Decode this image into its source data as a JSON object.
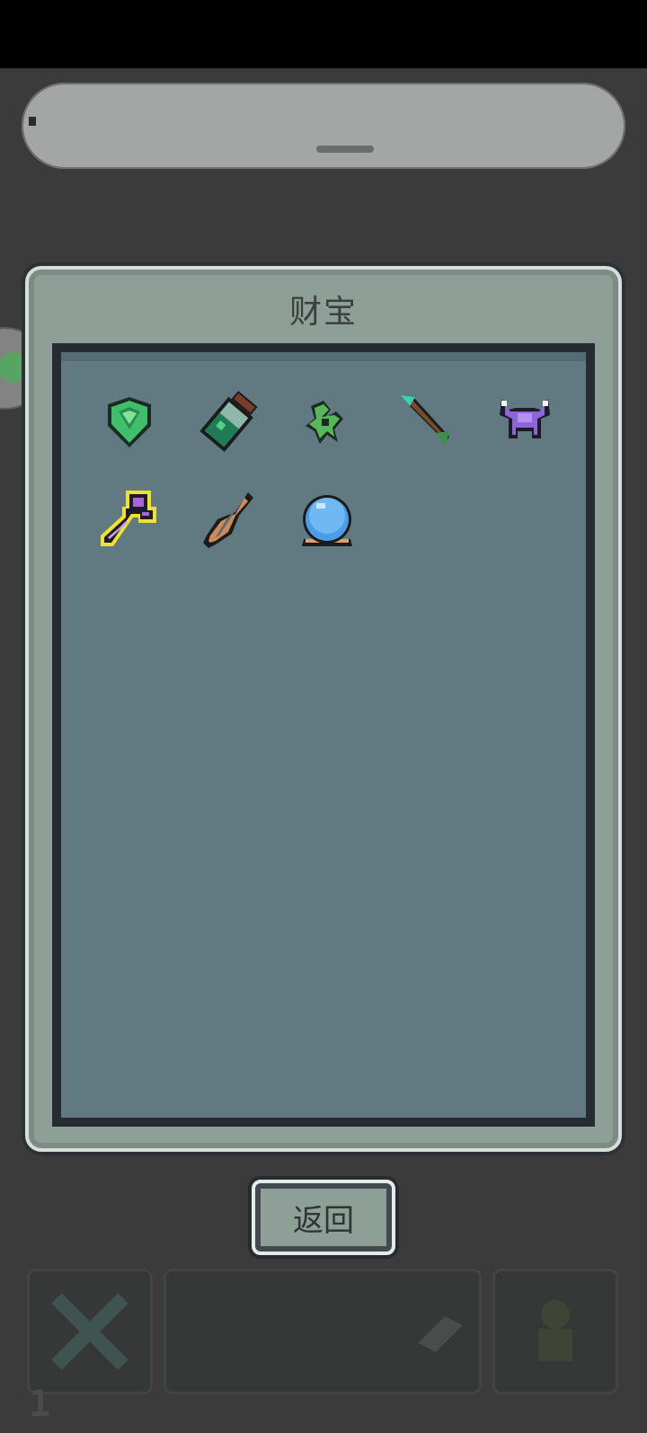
{
  "panel": {
    "title": "财宝"
  },
  "treasures": [
    {
      "name": "green-gem-icon"
    },
    {
      "name": "potion-jar-icon"
    },
    {
      "name": "green-wings-icon"
    },
    {
      "name": "arrow-icon"
    },
    {
      "name": "horned-armor-icon"
    },
    {
      "name": "purple-key-icon"
    },
    {
      "name": "feather-quill-icon"
    },
    {
      "name": "crystal-ball-icon"
    }
  ],
  "selected_index": 5,
  "buttons": {
    "return_label": "返回"
  },
  "background_hud": {
    "slot_number": "1"
  },
  "colors": {
    "panel": "#8e9f97",
    "inner": "#617a82",
    "highlight": "#f0e22a"
  }
}
